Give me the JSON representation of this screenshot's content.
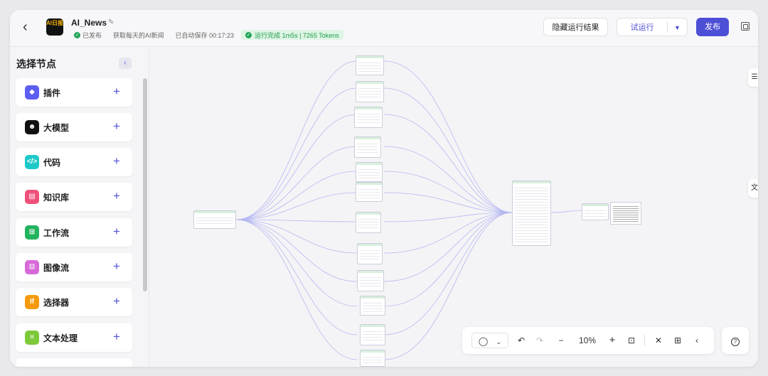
{
  "header": {
    "back_icon": "chevron-left-icon",
    "logo_text": "AI日报",
    "app_name": "AI_News",
    "status": "已发布",
    "description": "获取每天的AI新闻",
    "autosave": "已自动保存 00:17:23",
    "run_status": "运行完成 1m5s | 7265 Tokens",
    "hide_results_label": "隐藏运行结果",
    "try_run_label": "试运行",
    "publish_label": "发布",
    "colors": {
      "accent": "#4d4fd6",
      "success": "#22a55a",
      "success_bg": "#dff5e5"
    }
  },
  "sidebar": {
    "title": "选择节点",
    "items": [
      {
        "label": "插件",
        "icon": "cube-icon",
        "color": "#5b5ef0"
      },
      {
        "label": "大模型",
        "icon": "robot-face-icon",
        "color": "#111111"
      },
      {
        "label": "代码",
        "icon": "code-icon",
        "color": "#1ec8c8"
      },
      {
        "label": "知识库",
        "icon": "book-icon",
        "color": "#f0507a"
      },
      {
        "label": "工作流",
        "icon": "workflow-icon",
        "color": "#22b35e"
      },
      {
        "label": "图像流",
        "icon": "image-flow-icon",
        "color": "#d86ad8"
      },
      {
        "label": "选择器",
        "icon": "if-icon",
        "color": "#f59a0c"
      },
      {
        "label": "文本处理",
        "icon": "text-process-icon",
        "color": "#7dc93a"
      }
    ]
  },
  "canvas": {
    "right_tab_1": "☰",
    "right_tab_2": "文"
  },
  "toolbar": {
    "zoom": "10%",
    "mouse_icon": "mouse-icon",
    "help_icon": "question-icon"
  }
}
